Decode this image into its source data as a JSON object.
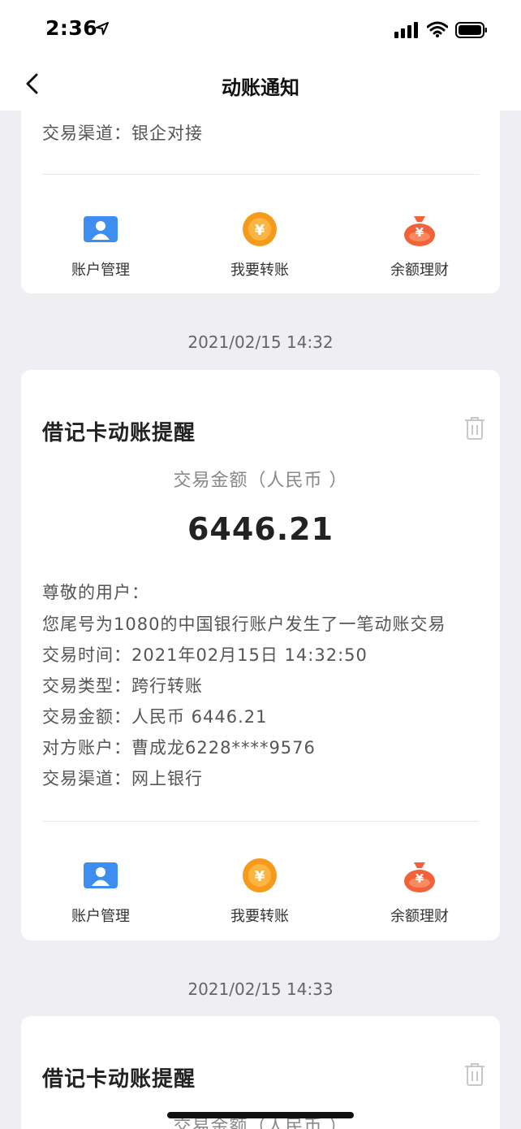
{
  "status_bar": {
    "time": "2:36"
  },
  "nav": {
    "title": "动账通知"
  },
  "actions": {
    "account": "账户管理",
    "transfer": "我要转账",
    "finance": "余额理财"
  },
  "partial_card": {
    "channel_line": "交易渠道：银企对接"
  },
  "notifications": [
    {
      "date": "2021/02/15 14:32",
      "title": "借记卡动账提醒",
      "amount_label": "交易金额（人民币 ）",
      "amount": "6446.21",
      "greeting": "尊敬的用户：",
      "message": "您尾号为1080的中国银行账户发生了一笔动账交易",
      "time_line": "交易时间：2021年02月15日 14:32:50",
      "type_line": "交易类型：跨行转账",
      "amount_line": "交易金额：人民币 6446.21",
      "counterparty_line": "对方账户：曹成龙6228****9576",
      "channel_line": "交易渠道：网上银行"
    },
    {
      "date": "2021/02/15 14:33",
      "title": "借记卡动账提醒",
      "amount_label": "交易金额（人民币 ）"
    }
  ],
  "colors": {
    "background": "#eeeef3",
    "account_icon": "#3d8ef0",
    "transfer_icon": "#f59a1b",
    "finance_icon": "#f2613a"
  },
  "icons": [
    "back-chevron-icon",
    "location-arrow-icon",
    "signal-icon",
    "wifi-icon",
    "battery-icon",
    "account-card-icon",
    "yuan-coin-icon",
    "money-bag-icon",
    "trash-icon"
  ]
}
